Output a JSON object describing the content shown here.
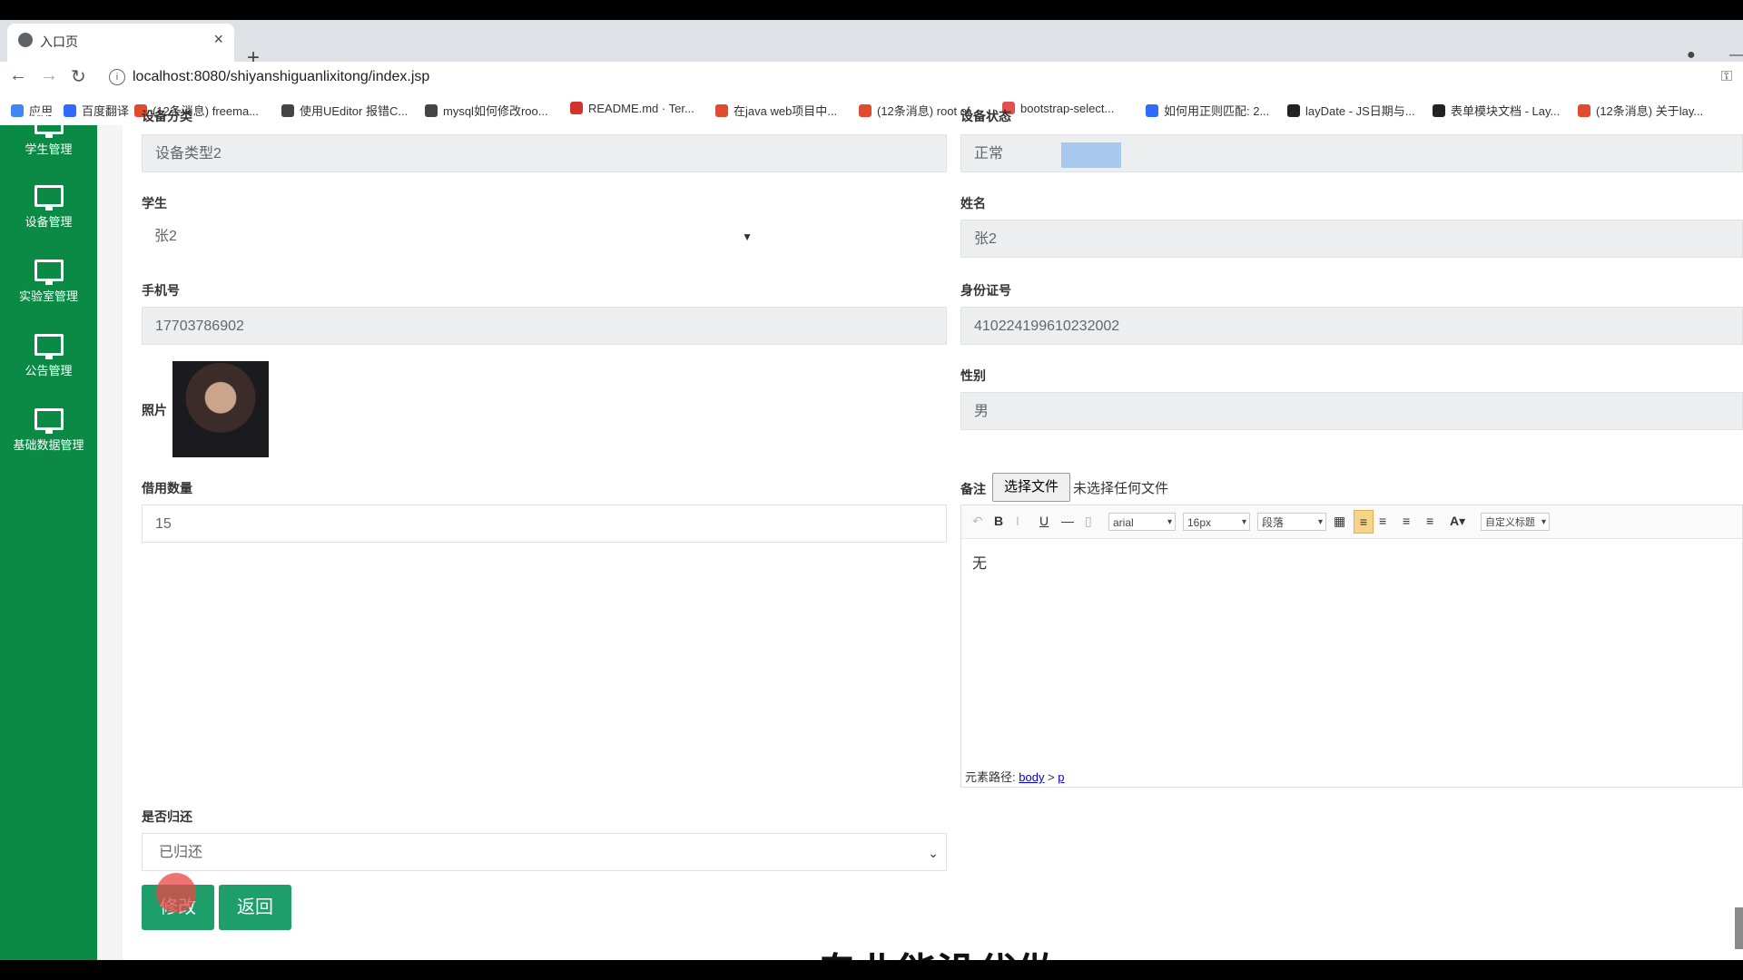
{
  "browser": {
    "tab_title": "入口页",
    "url": "localhost:8080/shiyanshiguanlixitong/index.jsp",
    "bookmarks": [
      {
        "label": "应用",
        "color": "#4285f4"
      },
      {
        "label": "百度翻译",
        "color": "#2f6bff"
      },
      {
        "label": "(12条消息) freema...",
        "color": "#e04a2f"
      },
      {
        "label": "使用UEditor 报错C...",
        "color": "#444444"
      },
      {
        "label": "mysql如何修改roo...",
        "color": "#444444"
      },
      {
        "label": "README.md · Ter...",
        "color": "#d0342c"
      },
      {
        "label": "在java web项目中...",
        "color": "#e04a2f"
      },
      {
        "label": "(12条消息) root of...",
        "color": "#e04a2f"
      },
      {
        "label": "bootstrap-select...",
        "color": "#e05050"
      },
      {
        "label": "如何用正则匹配: 2...",
        "color": "#2f6bff"
      },
      {
        "label": "layDate - JS日期与...",
        "color": "#222222"
      },
      {
        "label": "表单模块文档 - Lay...",
        "color": "#222222"
      },
      {
        "label": "(12条消息) 关于lay...",
        "color": "#e04a2f"
      }
    ]
  },
  "sidebar": {
    "items": [
      {
        "label": "学生管理"
      },
      {
        "label": "设备管理"
      },
      {
        "label": "实验室管理"
      },
      {
        "label": "公告管理"
      },
      {
        "label": "基础数据管理"
      }
    ]
  },
  "form": {
    "device_category_label": "设备分类",
    "device_category_value": "设备类型2",
    "device_status_label": "设备状态",
    "device_status_value": "正常",
    "student_label": "学生",
    "student_value": "张2",
    "name_label": "姓名",
    "name_value": "张2",
    "phone_label": "手机号",
    "phone_value": "17703786902",
    "idcard_label": "身份证号",
    "idcard_value": "410224199610232002",
    "photo_label": "照片",
    "gender_label": "性别",
    "gender_value": "男",
    "borrow_qty_label": "借用数量",
    "borrow_qty_value": "15",
    "remark_label": "备注",
    "file_button": "选择文件",
    "file_status": "未选择任何文件",
    "editor": {
      "font": "arial",
      "size": "16px",
      "paragraph": "段落",
      "custom_title": "自定义标题",
      "content": "无",
      "path_label": "元素路径:",
      "path_body": "body",
      "path_sep": ">",
      "path_p": "p"
    },
    "returned_label": "是否归还",
    "returned_value": "已归还",
    "submit_button": "修改",
    "back_button": "返回"
  },
  "overlay": {
    "subtitle": "专业能没代做"
  }
}
